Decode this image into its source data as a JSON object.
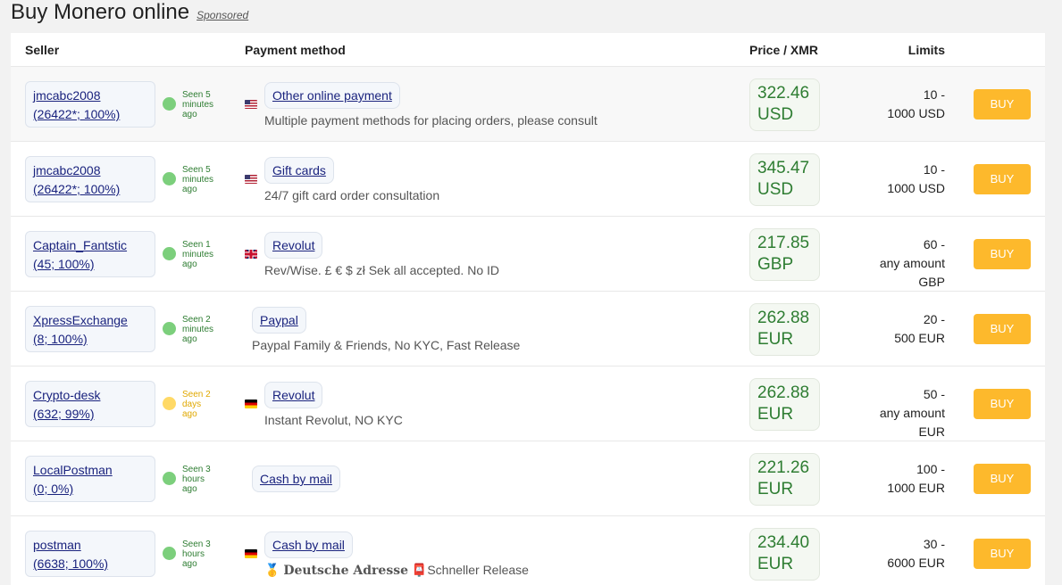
{
  "page": {
    "title": "Buy Monero online",
    "sponsored": "Sponsored"
  },
  "table": {
    "headers": {
      "seller": "Seller",
      "payment": "Payment method",
      "price": "Price / XMR",
      "limits": "Limits"
    },
    "rows": [
      {
        "seller_name": "jmcabc2008",
        "seller_stats": "(26422*; 100%)",
        "status": "online",
        "seen": [
          "Seen 5",
          "minutes",
          "ago"
        ],
        "flag": "us-flag",
        "payment_method": "Other online payment",
        "description": "Multiple payment methods for placing orders, please consult",
        "price_amount": "322.46",
        "price_currency": "USD",
        "limit_line1": "10 -",
        "limit_line2": "1000 USD",
        "limit_line3": "",
        "buy": "BUY"
      },
      {
        "seller_name": "jmcabc2008",
        "seller_stats": "(26422*; 100%)",
        "status": "online",
        "seen": [
          "Seen 5",
          "minutes",
          "ago"
        ],
        "flag": "us-flag",
        "payment_method": "Gift cards",
        "description": "24/7 gift card order consultation",
        "price_amount": "345.47",
        "price_currency": "USD",
        "limit_line1": "10 -",
        "limit_line2": "1000 USD",
        "limit_line3": "",
        "buy": "BUY"
      },
      {
        "seller_name": "Captain_Fantstic",
        "seller_stats": "(45; 100%)",
        "status": "online",
        "seen": [
          "Seen 1",
          "minutes",
          "ago"
        ],
        "flag": "gb-flag",
        "payment_method": "Revolut",
        "description": "Rev/Wise. £ € $ zł Sek all accepted. No ID",
        "price_amount": "217.85",
        "price_currency": "GBP",
        "limit_line1": "60 -",
        "limit_line2": "any amount",
        "limit_line3": "GBP",
        "buy": "BUY"
      },
      {
        "seller_name": "XpressExchange",
        "seller_stats": "(8; 100%)",
        "status": "online",
        "seen": [
          "Seen 2",
          "minutes",
          "ago"
        ],
        "flag": "",
        "payment_method": "Paypal",
        "description": "Paypal Family & Friends, No KYC, Fast Release",
        "price_amount": "262.88",
        "price_currency": "EUR",
        "limit_line1": "20 -",
        "limit_line2": "500 EUR",
        "limit_line3": "",
        "buy": "BUY"
      },
      {
        "seller_name": "Crypto-desk",
        "seller_stats": "(632; 99%)",
        "status": "away",
        "seen": [
          "Seen 2",
          "days",
          "ago"
        ],
        "flag": "de-flag",
        "payment_method": "Revolut",
        "description": "Instant Revolut, NO KYC",
        "price_amount": "262.88",
        "price_currency": "EUR",
        "limit_line1": "50 -",
        "limit_line2": "any amount",
        "limit_line3": "EUR",
        "buy": "BUY"
      },
      {
        "seller_name": "LocalPostman",
        "seller_stats": "(0; 0%)",
        "status": "online",
        "seen": [
          "Seen 3",
          "hours",
          "ago"
        ],
        "flag": "",
        "payment_method": "Cash by mail",
        "description": "",
        "price_amount": "221.26",
        "price_currency": "EUR",
        "limit_line1": "100 -",
        "limit_line2": "1000 EUR",
        "limit_line3": "",
        "buy": "BUY"
      },
      {
        "seller_name": "postman",
        "seller_stats": "(6638; 100%)",
        "status": "online",
        "seen": [
          "Seen 3",
          "hours",
          "ago"
        ],
        "flag": "de-flag",
        "payment_method": "Cash by mail",
        "description_parts": [
          "🥇 ",
          "Deutsche Adresse",
          " 📮Schneller Release"
        ],
        "price_amount": "234.40",
        "price_currency": "EUR",
        "limit_line1": "30 -",
        "limit_line2": "6000 EUR",
        "limit_line3": "",
        "buy": "BUY"
      }
    ]
  }
}
